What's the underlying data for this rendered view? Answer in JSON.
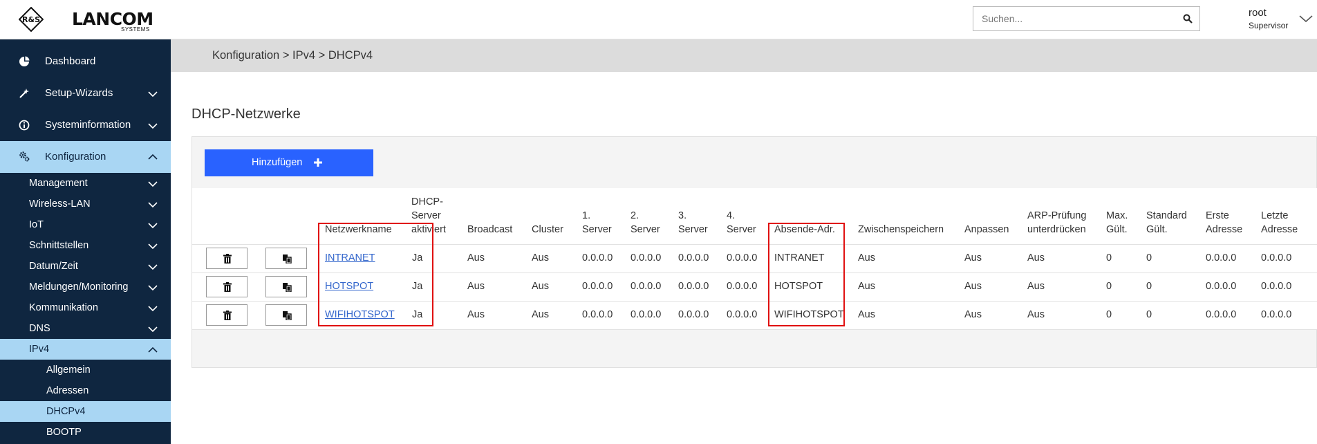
{
  "header": {
    "brand": "LANCOM",
    "brand_sub": "SYSTEMS",
    "logo_mark": "R&S",
    "search_placeholder": "Suchen...",
    "user_name": "root",
    "user_role": "Supervisor"
  },
  "sidebar": {
    "items": [
      {
        "label": "Dashboard",
        "icon": "dashboard-icon"
      },
      {
        "label": "Setup-Wizards",
        "icon": "wand-icon"
      },
      {
        "label": "Systeminformation",
        "icon": "info-icon"
      },
      {
        "label": "Konfiguration",
        "icon": "gears-icon"
      }
    ],
    "sub_items": [
      {
        "label": "Management"
      },
      {
        "label": "Wireless-LAN"
      },
      {
        "label": "IoT"
      },
      {
        "label": "Schnittstellen"
      },
      {
        "label": "Datum/Zeit"
      },
      {
        "label": "Meldungen/Monitoring"
      },
      {
        "label": "Kommunikation"
      },
      {
        "label": "DNS"
      },
      {
        "label": "IPv4"
      }
    ],
    "ipv4_items": [
      {
        "label": "Allgemein"
      },
      {
        "label": "Adressen"
      },
      {
        "label": "DHCPv4"
      },
      {
        "label": "BOOTP"
      }
    ]
  },
  "breadcrumb": "Konfiguration > IPv4 > DHCPv4",
  "section_title": "DHCP-Netzwerke",
  "add_button": "Hinzufügen",
  "table": {
    "headers": {
      "name": [
        "Netzwerkname"
      ],
      "dhcp": [
        "DHCP-",
        "Server",
        "aktiviert"
      ],
      "broadcast": [
        "Broadcast"
      ],
      "cluster": [
        "Cluster"
      ],
      "s1": [
        "1.",
        "Server"
      ],
      "s2": [
        "2.",
        "Server"
      ],
      "s3": [
        "3.",
        "Server"
      ],
      "s4": [
        "4.",
        "Server"
      ],
      "absende": [
        "Absende-Adr."
      ],
      "zwischen": [
        "Zwischenspeichern"
      ],
      "anpassen": [
        "Anpassen"
      ],
      "arp": [
        "ARP-Prüfung",
        "unterdrücken"
      ],
      "max": [
        "Max.",
        "Gült."
      ],
      "standard": [
        "Standard",
        "Gült."
      ],
      "erste": [
        "Erste",
        "Adresse"
      ],
      "letzte": [
        "Letzte",
        "Adresse"
      ]
    },
    "rows": [
      {
        "name": "INTRANET",
        "dhcp": "Ja",
        "broadcast": "Aus",
        "cluster": "Aus",
        "s1": "0.0.0.0",
        "s2": "0.0.0.0",
        "s3": "0.0.0.0",
        "s4": "0.0.0.0",
        "absende": "INTRANET",
        "zwischen": "Aus",
        "anpassen": "Aus",
        "arp": "Aus",
        "max": "0",
        "standard": "0",
        "erste": "0.0.0.0",
        "letzte": "0.0.0.0"
      },
      {
        "name": "HOTSPOT",
        "dhcp": "Ja",
        "broadcast": "Aus",
        "cluster": "Aus",
        "s1": "0.0.0.0",
        "s2": "0.0.0.0",
        "s3": "0.0.0.0",
        "s4": "0.0.0.0",
        "absende": "HOTSPOT",
        "zwischen": "Aus",
        "anpassen": "Aus",
        "arp": "Aus",
        "max": "0",
        "standard": "0",
        "erste": "0.0.0.0",
        "letzte": "0.0.0.0"
      },
      {
        "name": "WIFIHOTSPOT",
        "dhcp": "Ja",
        "broadcast": "Aus",
        "cluster": "Aus",
        "s1": "0.0.0.0",
        "s2": "0.0.0.0",
        "s3": "0.0.0.0",
        "s4": "0.0.0.0",
        "absende": "WIFIHOTSPOT",
        "zwischen": "Aus",
        "anpassen": "Aus",
        "arp": "Aus",
        "max": "0",
        "standard": "0",
        "erste": "0.0.0.0",
        "letzte": "0.0.0.0"
      }
    ]
  },
  "colors": {
    "sidebar_bg": "#0f2640",
    "sidebar_active": "#a9d6f3",
    "accent": "#2962ff",
    "highlight": "#e01010",
    "link": "#3366cc"
  }
}
